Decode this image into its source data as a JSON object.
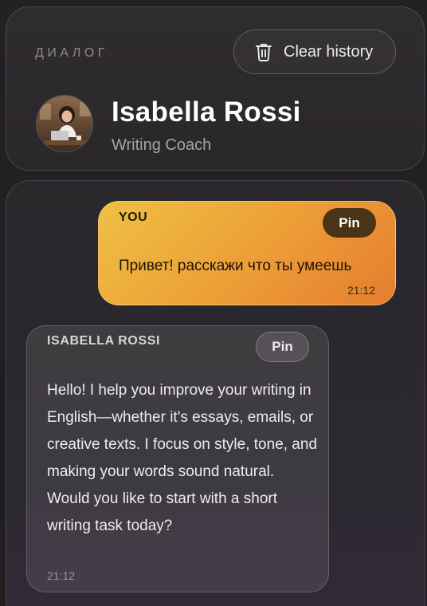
{
  "header": {
    "section_label": "ДИАЛОГ",
    "clear_button_label": "Clear history",
    "clear_icon": "trash-icon"
  },
  "contact": {
    "name": "Isabella Rossi",
    "role": "Writing Coach",
    "avatar": "avatar-photo"
  },
  "messages": [
    {
      "author": "YOU",
      "pin_label": "Pin",
      "text": "Привет! расскажи что ты умеешь",
      "time": "21:12"
    },
    {
      "author": "ISABELLA ROSSI",
      "pin_label": "Pin",
      "text": "Hello! I help you improve your writing in English—whether it's essays, emails, or creative texts. I focus on style, tone, and making your words sound natural. Would you like to start with a short writing task today?",
      "time": "21:12"
    }
  ],
  "colors": {
    "user_bubble": "#eda038",
    "bot_bubble": "#3f3c40",
    "background": "#1e1c1f"
  }
}
